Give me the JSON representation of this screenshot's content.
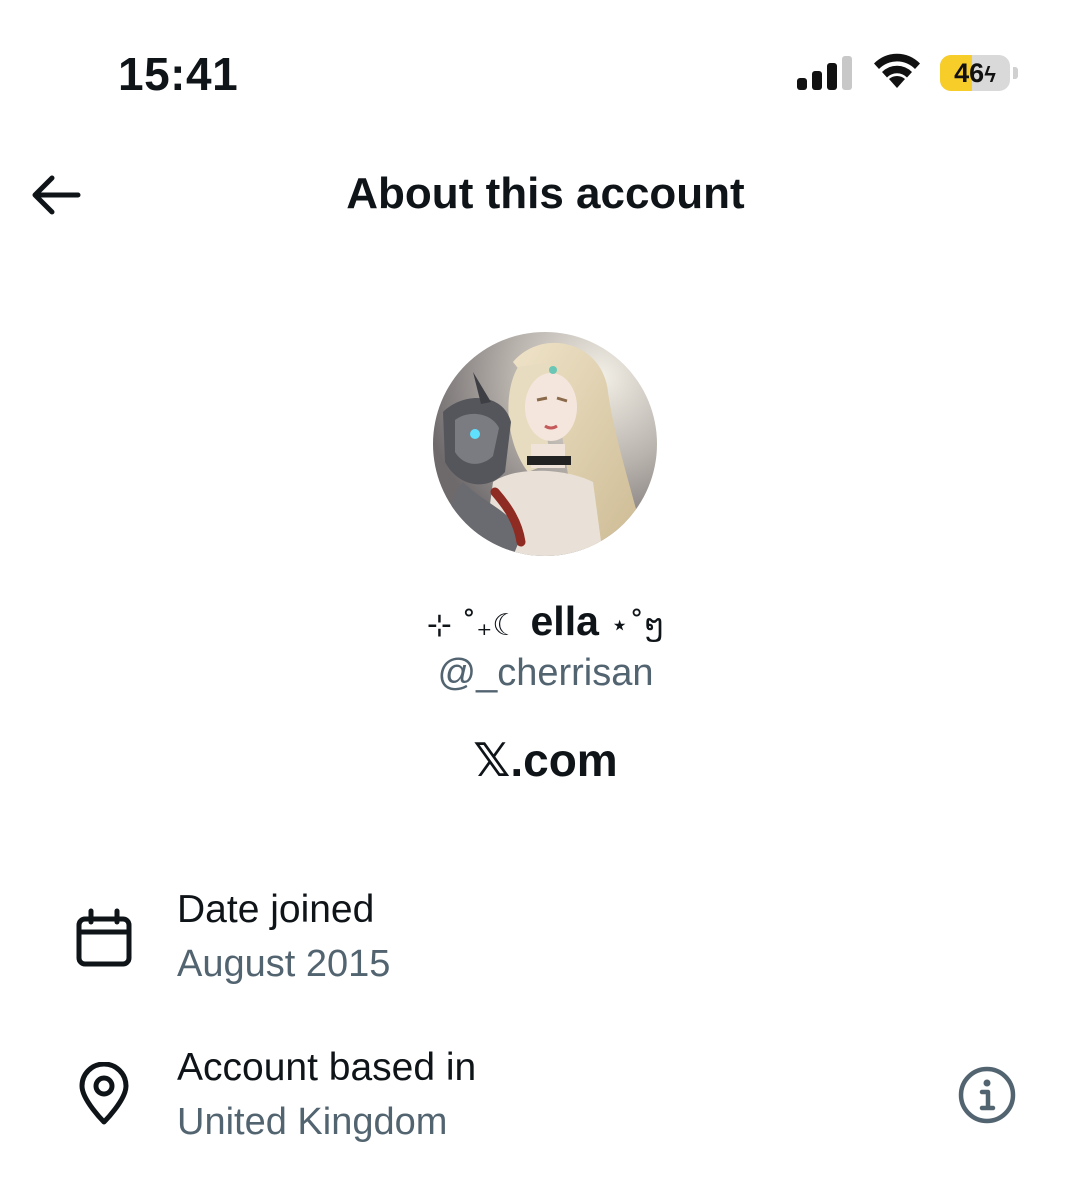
{
  "status_bar": {
    "time": "15:41",
    "battery_level": "46",
    "battery_fraction": 0.46,
    "battery_charging": true,
    "signal_icon": "cellular-signal-icon",
    "wifi_icon": "wifi-icon"
  },
  "header": {
    "back_icon": "back-arrow-icon",
    "title": "About this account"
  },
  "profile": {
    "avatar_description_icon": "avatar",
    "display_name_prefix": "⊹ ˚₊☾",
    "display_name": "ella",
    "display_name_suffix": "⋆˚ໆ",
    "handle": "@_cherrisan",
    "site": "𝕏.com"
  },
  "details": [
    {
      "icon": "calendar-icon",
      "label": "Date joined",
      "value": "August 2015"
    },
    {
      "icon": "location-pin-icon",
      "label": "Account based in",
      "value": "United Kingdom",
      "action_icon": "info-icon"
    }
  ],
  "colors": {
    "text_primary": "#0f1419",
    "text_secondary": "#536471",
    "battery_accent": "#f7cd2a",
    "background": "#ffffff"
  }
}
